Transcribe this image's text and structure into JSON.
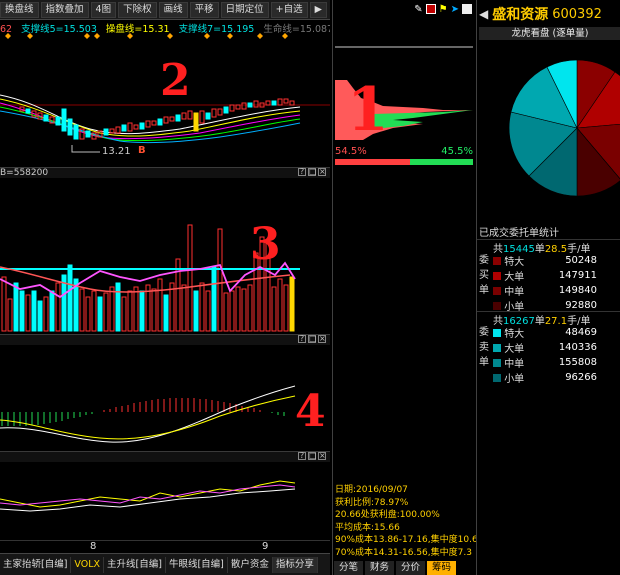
{
  "toolbar": {
    "items": [
      "换盘线",
      "指数叠加",
      "4图",
      "下除权",
      "画线",
      "平移",
      "日期定位",
      "+自选"
    ],
    "next_arrow": "▶"
  },
  "main_chart": {
    "legend_fragments": [
      "62",
      "支撑线5=15.503",
      "操盘线=15.31",
      "支撑线7=15.195",
      "生命线=15.087"
    ],
    "low_label": "13.21",
    "signal_label": "B",
    "annotation": "2"
  },
  "volume_panel": {
    "legend": "B=558200",
    "annotation": "3"
  },
  "macd_panel": {
    "annotation": "4"
  },
  "xaxis": {
    "ticks": [
      "8",
      "9"
    ]
  },
  "bottom_tabs": [
    "主家抬轿[自编]",
    "VOLX",
    "主升线[自编]",
    "牛眼线[自编]",
    "散户资金",
    "指标分享"
  ],
  "chip_panel": {
    "annotation": "1",
    "left_pct": "54.5%",
    "right_pct": "45.5%",
    "date": "日期:2016/09/07",
    "profit_ratio": "获利比例:78.97%",
    "profit_line": "20.66处获利盘:100.00%",
    "avg_cost": "平均成本:15.66",
    "cost90": "90%成本13.86-17.16,集中度10.6",
    "cost70": "70%成本14.31-16.56,集中度7.3",
    "tabs": [
      "分笔",
      "财务",
      "分价",
      "筹码"
    ]
  },
  "right_panel": {
    "stock_name": "盛和资源",
    "stock_code": "600392",
    "back_arrow": "◀",
    "pie_title": "龙虎看盘 (逐单量)",
    "stats_title": "已成交委托单统计",
    "buy": {
      "summary_prefix": "共",
      "summary_count": "15445",
      "summary_mid": "单",
      "summary_avg": "28.5",
      "summary_suffix": "手/单",
      "side_label": [
        "委",
        "买",
        "单"
      ],
      "rows": [
        {
          "label": "特大",
          "value": "50248",
          "color": "#8b0000"
        },
        {
          "label": "大单",
          "value": "147911",
          "color": "#b00000"
        },
        {
          "label": "中单",
          "value": "149840",
          "color": "#7a0000"
        },
        {
          "label": "小单",
          "value": "92880",
          "color": "#4a0000"
        }
      ]
    },
    "sell": {
      "summary_prefix": "共",
      "summary_count": "16267",
      "summary_mid": "单",
      "summary_avg": "27.1",
      "summary_suffix": "手/单",
      "side_label": [
        "委",
        "卖",
        "单"
      ],
      "rows": [
        {
          "label": "特大",
          "value": "48469",
          "color": "#00e5ee"
        },
        {
          "label": "大单",
          "value": "140336",
          "color": "#00a8b0"
        },
        {
          "label": "中单",
          "value": "155808",
          "color": "#008890"
        },
        {
          "label": "小单",
          "value": "96266",
          "color": "#006870"
        }
      ]
    }
  },
  "colors": {
    "up": "#ff3030",
    "down": "#00ffff",
    "accent_yellow": "#ffd700"
  }
}
